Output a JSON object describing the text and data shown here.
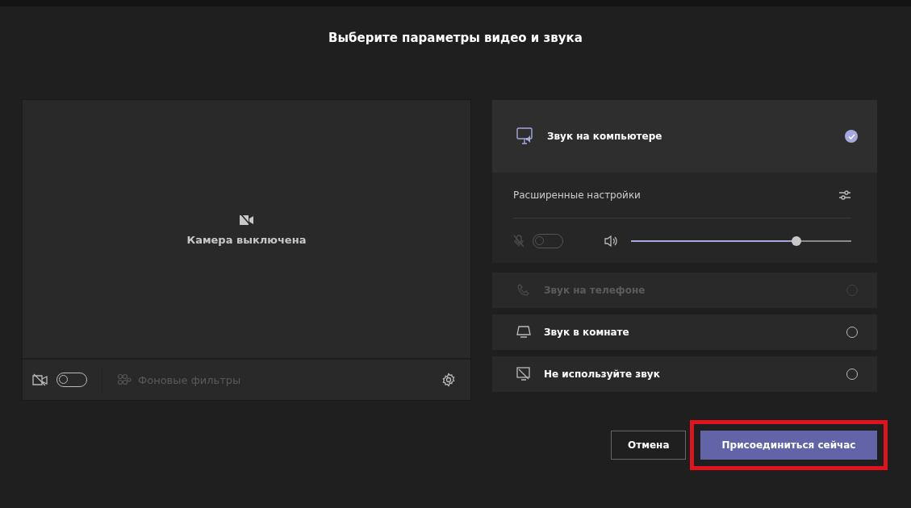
{
  "title": "Выберите параметры видео и звука",
  "camera": {
    "status_text": "Камера выключена",
    "video_on": false,
    "filters": {
      "label": "Фоновые фильтры",
      "disabled": true
    }
  },
  "audio_options": [
    {
      "kind": "computer",
      "label": "Звук на компьютере",
      "selected": true,
      "disabled": false,
      "expanded": true
    },
    {
      "kind": "phone",
      "label": "Звук на телефоне",
      "selected": false,
      "disabled": true,
      "expanded": false
    },
    {
      "kind": "room",
      "label": "Звук в комнате",
      "selected": false,
      "disabled": false,
      "expanded": false
    },
    {
      "kind": "none",
      "label": "Не используйте звук",
      "selected": false,
      "disabled": false,
      "expanded": false
    }
  ],
  "advanced": {
    "label": "Расширенные настройки",
    "mic_on": false,
    "mic_disabled": true,
    "volume": {
      "level": 0.75
    }
  },
  "buttons": [
    {
      "kind": "secondary",
      "label": "Отмена",
      "highlighted": false
    },
    {
      "kind": "primary",
      "label": "Присоединиться сейчас",
      "highlighted": true
    }
  ]
}
